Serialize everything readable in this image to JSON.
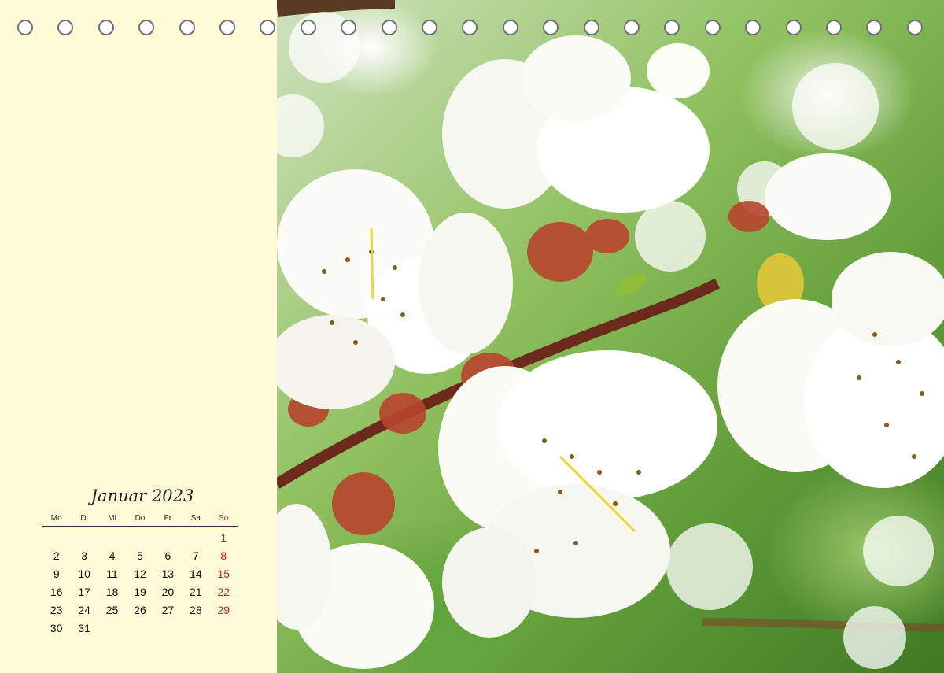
{
  "calendar": {
    "month_title": "Januar 2023",
    "weekdays": [
      "Mo",
      "Di",
      "Mi",
      "Do",
      "Fr",
      "Sa",
      "So"
    ],
    "weeks": [
      [
        "",
        "",
        "",
        "",
        "",
        "",
        "1"
      ],
      [
        "2",
        "3",
        "4",
        "5",
        "6",
        "7",
        "8"
      ],
      [
        "9",
        "10",
        "11",
        "12",
        "13",
        "14",
        "15"
      ],
      [
        "16",
        "17",
        "18",
        "19",
        "20",
        "21",
        "22"
      ],
      [
        "23",
        "24",
        "25",
        "26",
        "27",
        "28",
        "29"
      ],
      [
        "30",
        "31",
        "",
        "",
        "",
        "",
        ""
      ]
    ],
    "sunday_color": "#d0202a",
    "panel_color": "#fffbd9"
  },
  "binding": {
    "ring_count": 23,
    "ring_color": "#707070"
  },
  "photo": {
    "subject": "cherry-blossom-photo"
  }
}
